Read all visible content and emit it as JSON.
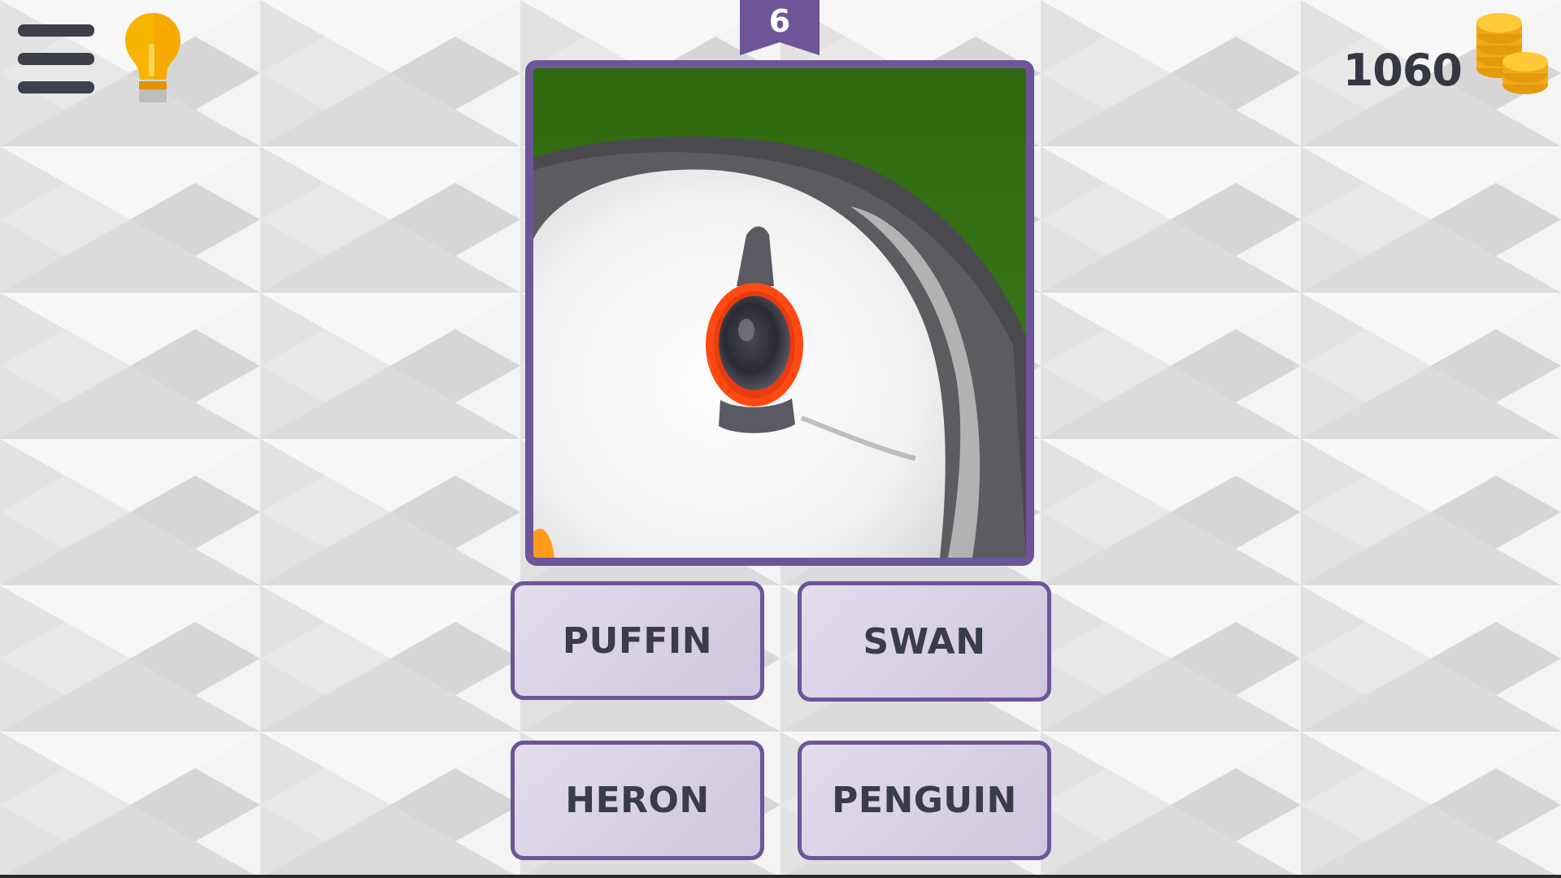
{
  "game": {
    "level": "6",
    "coins": "1060"
  },
  "toolbar": {
    "menu_icon": "hamburger-menu-icon",
    "hint_icon": "lightbulb-icon",
    "coins_icon": "coin-stack-icon"
  },
  "question": {
    "image_subject": "puffin-eye-closeup"
  },
  "answers": [
    {
      "label": "PUFFIN"
    },
    {
      "label": "SWAN"
    },
    {
      "label": "HERON"
    },
    {
      "label": "PENGUIN"
    }
  ],
  "colors": {
    "accent_purple": "#6d5598",
    "button_fill": "#d9d1e6",
    "text_dark": "#353743",
    "bulb_yellow": "#f7b500",
    "coin_gold": "#f5b21a"
  }
}
